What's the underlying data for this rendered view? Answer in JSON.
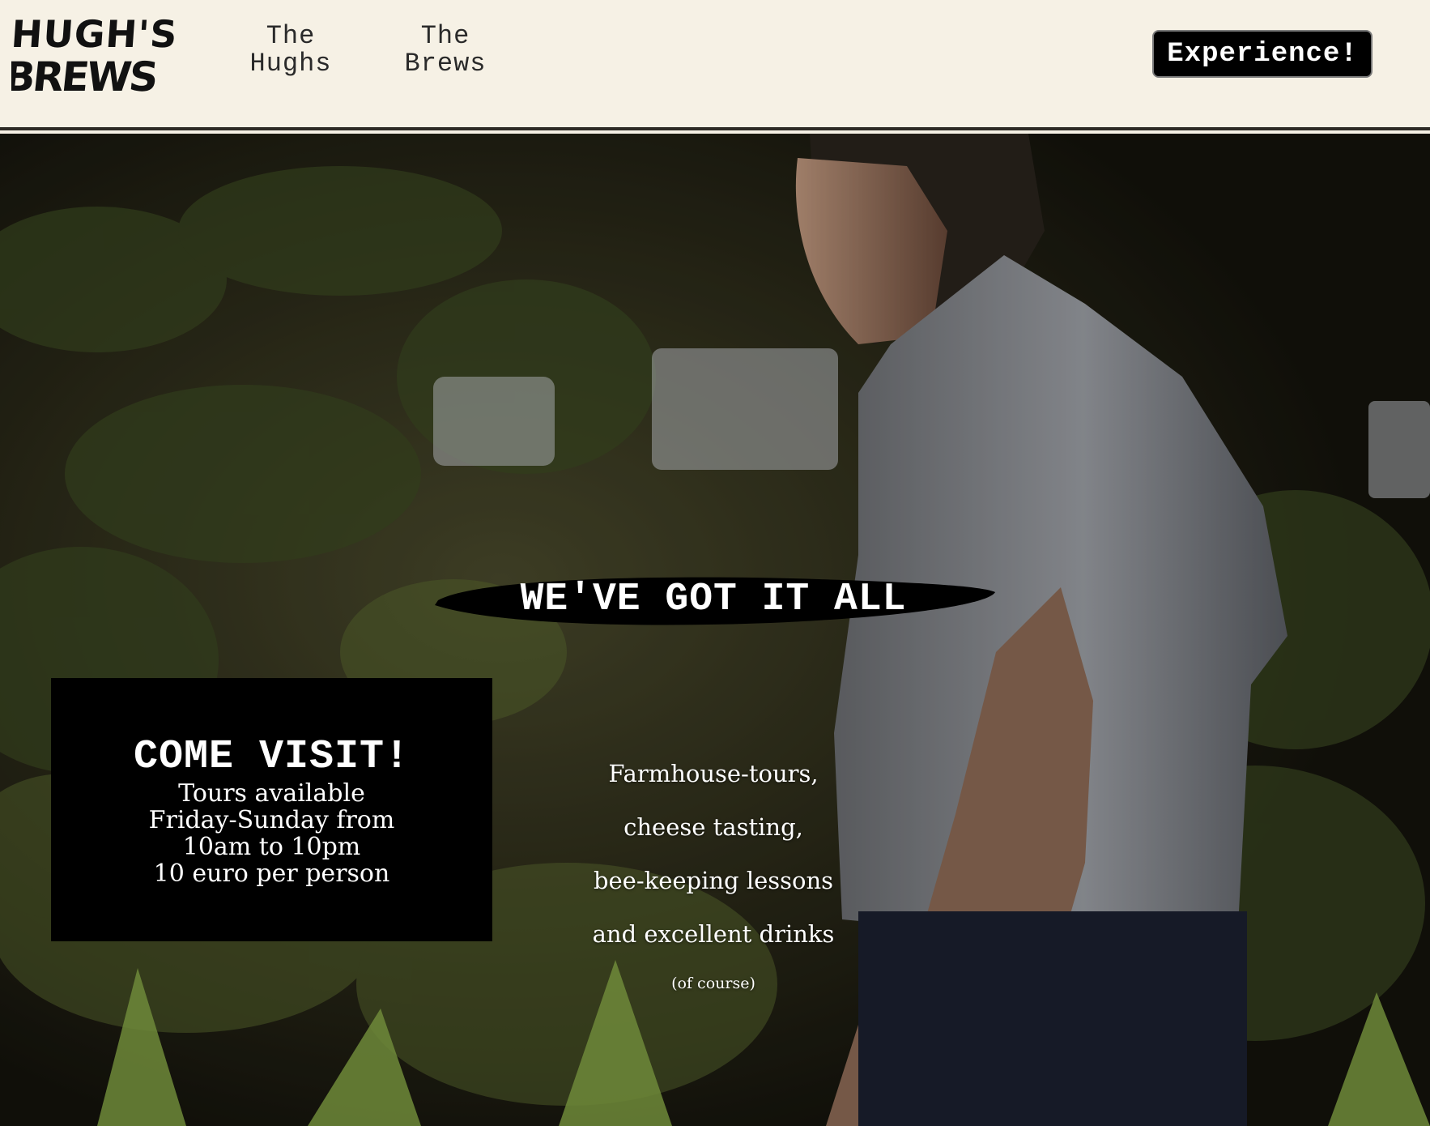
{
  "brand": {
    "logo_line1": "HUGH'S",
    "logo_line2": "BREWS"
  },
  "nav": {
    "items": [
      {
        "line1": "The",
        "line2": "Hughs"
      },
      {
        "line1": "The",
        "line2": "Brews"
      }
    ],
    "cta_label": "Experience!"
  },
  "hero": {
    "headline": "WE'VE GOT IT ALL",
    "visit": {
      "title": "COME VISIT!",
      "lines": [
        "Tours available",
        "Friday-Sunday from",
        "10am to 10pm",
        "10 euro per person"
      ]
    },
    "offerings": [
      "Farmhouse-tours,",
      "cheese tasting,",
      "bee-keeping lessons",
      "and excellent drinks"
    ],
    "footnote": "(of course)"
  },
  "colors": {
    "header_bg": "#f6f1e5",
    "header_border": "#2e2b26",
    "button_bg": "#000000",
    "text_light": "#ffffff"
  }
}
